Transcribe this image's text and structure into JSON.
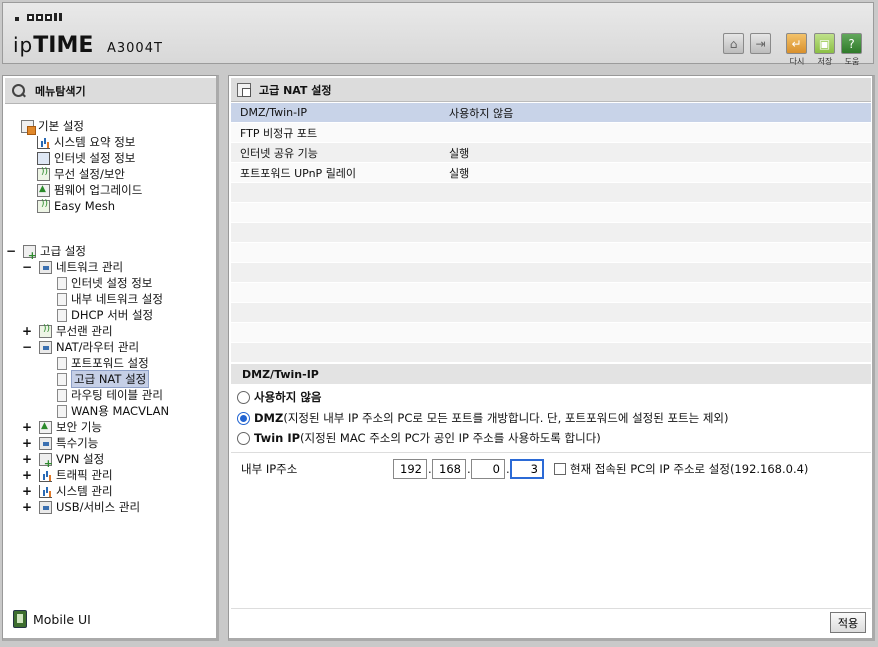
{
  "header": {
    "brand": "ipTIME",
    "model": "A3004T",
    "buttons": [
      {
        "name": "home",
        "label": ""
      },
      {
        "name": "logout",
        "label": ""
      },
      {
        "name": "restart",
        "label": "다시"
      },
      {
        "name": "save",
        "label": "저장"
      },
      {
        "name": "help",
        "label": "도움"
      }
    ]
  },
  "menu": {
    "title": "메뉴탐색기",
    "basic": {
      "label": "기본 설정",
      "items": [
        "시스템 요약 정보",
        "인터넷 설정 정보",
        "무선 설정/보안",
        "펌웨어 업그레이드",
        "Easy Mesh"
      ]
    },
    "advanced": {
      "label": "고급 설정",
      "network": {
        "label": "네트워크 관리",
        "items": [
          "인터넷 설정 정보",
          "내부 네트워크 설정",
          "DHCP 서버 설정"
        ]
      },
      "wireless": "무선랜 관리",
      "nat": {
        "label": "NAT/라우터 관리",
        "items": [
          "포트포워드 설정",
          "고급 NAT 설정",
          "라우팅 테이블 관리",
          "WAN용 MACVLAN"
        ]
      },
      "others": [
        "보안 기능",
        "특수기능",
        "VPN 설정",
        "트래픽 관리",
        "시스템 관리",
        "USB/서비스 관리"
      ]
    },
    "mobile_ui": "Mobile UI"
  },
  "main": {
    "title": "고급 NAT 설정",
    "summary": [
      {
        "key": "DMZ/Twin-IP",
        "value": "사용하지 않음"
      },
      {
        "key": "FTP 비정규 포트",
        "value": ""
      },
      {
        "key": "인터넷 공유 기능",
        "value": "실행"
      },
      {
        "key": "포트포워드 UPnP 릴레이",
        "value": "실행"
      }
    ],
    "section_title": "DMZ/Twin-IP",
    "options": {
      "none": {
        "label": "사용하지 않음",
        "desc": ""
      },
      "dmz": {
        "label": "DMZ",
        "desc": " (지정된 내부 IP 주소의 PC로 모든 포트를 개방합니다. 단, 포트포워드에 설정된 포트는 제외)"
      },
      "twin": {
        "label": "Twin IP",
        "desc": " (지정된 MAC 주소의 PC가 공인 IP 주소를 사용하도록 합니다)"
      }
    },
    "selected_option": "dmz",
    "ip": {
      "label": "내부 IP주소",
      "octets": [
        "192",
        "168",
        "0",
        "3"
      ],
      "checkbox_label": "현재 접속된 PC의 IP 주소로 설정(192.168.0.4)"
    },
    "apply_label": "적용"
  }
}
